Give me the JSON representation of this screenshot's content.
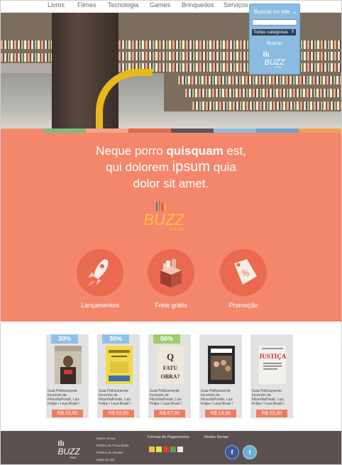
{
  "nav": {
    "items": [
      "Livros",
      "Filmes",
      "Tecnologia",
      "Games",
      "Brinquedos",
      "Serviços"
    ]
  },
  "search": {
    "title": "Buscar no site",
    "category": "Todas categorias",
    "button": "Buscar"
  },
  "brand": {
    "name": "BUZZ",
    "sub": "FEAT"
  },
  "colors": {
    "salmon": "#f4866c",
    "salmon_dark": "#e96a50",
    "blue": "#8bbbe0",
    "footer": "#5a5150",
    "stripe": [
      "#f28a6d",
      "#7dbb7e",
      "#f5a48a",
      "#e26a52",
      "#5c5554",
      "#8bbbe0",
      "#6ca0cf",
      "#f2a253"
    ]
  },
  "headline": {
    "line1_a": "Neque porro ",
    "line1_b": "quisquam",
    "line1_c": " est,",
    "line2_a": "qui dolorem ",
    "line2_b": "ipsum",
    "line2_c": " quia",
    "line3": "dolor sit amet."
  },
  "features": [
    {
      "label": "Lançamentos",
      "icon": "rocket-icon"
    },
    {
      "label": "Frete grátis",
      "icon": "gift-box-icon"
    },
    {
      "label": "Promoção",
      "icon": "price-tag-icon"
    }
  ],
  "products": [
    {
      "discount": "30%",
      "desc": "Guia Politicamente Incorreto da FilosofiaPondé, Luiz Felipe / Leya Brasil /",
      "price": "R$ 23,00",
      "cover": "book-cover-man"
    },
    {
      "discount": "30%",
      "desc": "Guia Politicamente Incorreto da FilosofiaPondé, Luiz Felipe / Leya Brasil /",
      "price": "R$ 52,00",
      "cover": "book-cover-yellow"
    },
    {
      "discount": "50%",
      "desc": "Guia Politicamente Incorreto da FilosofiaPondé, Luiz Felipe / Leya Brasil /",
      "price": "R$ 67,00",
      "cover": "book-cover-text"
    },
    {
      "discount": "",
      "desc": "Guia Politicamente Incorreto da FilosofiaPondé, Luiz Felipe / Leya Brasil /",
      "price": "R$ 19,00",
      "cover": "book-cover-dark"
    },
    {
      "discount": "",
      "desc": "Guia Politicamente Incorreto da FilosofiaPondé, Luiz Felipe / Leya Brasil /",
      "price": "R$ 25,00",
      "cover": "book-cover-justica"
    }
  ],
  "book_texts": {
    "cover3": "Q FATU OBRA?",
    "cover5": "JUSTIÇA"
  },
  "footer": {
    "links": [
      "Quem somos",
      "Política de Privacidade",
      "Política de Vendas",
      "Mapa do site"
    ],
    "payments_title": "Formas de Pagamentos",
    "social_title": "Redes Socias"
  }
}
